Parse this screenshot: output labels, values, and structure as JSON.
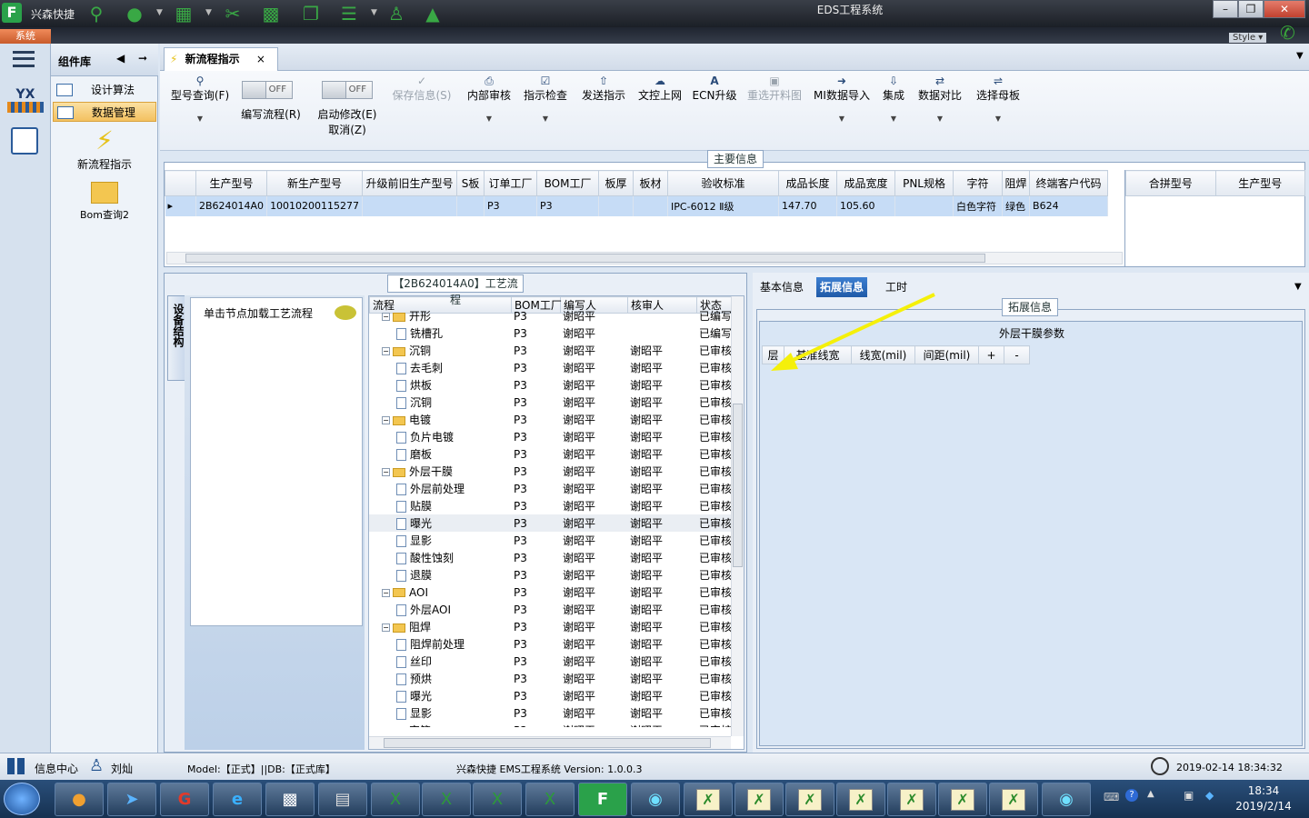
{
  "app": {
    "name": "兴森快捷",
    "window_title": "EDS工程系统",
    "system_tab": "系统",
    "style_label": "Style"
  },
  "left_nav": {
    "yx_label": "YX"
  },
  "component_panel": {
    "title": "组件库",
    "items": [
      {
        "label": "设计算法"
      },
      {
        "label": "数据管理"
      }
    ],
    "tools": [
      {
        "label": "新流程指示"
      },
      {
        "label": "Bom查询2"
      }
    ]
  },
  "doc_tab": {
    "label": "新流程指示",
    "close": "×"
  },
  "toolbar": {
    "buttons": [
      {
        "label": "型号查询(F)",
        "icon": "search-icon",
        "disabled": false
      },
      {
        "label": "保存信息(S)",
        "icon": "check-icon",
        "disabled": true
      },
      {
        "label": "内部审核",
        "icon": "print-icon",
        "disabled": false
      },
      {
        "label": "指示检查",
        "icon": "check-icon",
        "disabled": false
      },
      {
        "label": "发送指示",
        "icon": "upload-icon",
        "disabled": false
      },
      {
        "label": "文控上网",
        "icon": "cloud-upload-icon",
        "disabled": false
      },
      {
        "label": "ECN升级",
        "icon": "ecn-icon",
        "disabled": false
      },
      {
        "label": "重选开料图",
        "icon": "image-icon",
        "disabled": true
      },
      {
        "label": "MI数据导入",
        "icon": "import-icon",
        "disabled": false
      },
      {
        "label": "集成",
        "icon": "download-icon",
        "disabled": false
      },
      {
        "label": "数据对比",
        "icon": "compare-icon",
        "disabled": false
      },
      {
        "label": "选择母板",
        "icon": "shuffle-icon",
        "disabled": false
      }
    ],
    "toggles": [
      {
        "state": "OFF",
        "label": "编写流程(R)"
      },
      {
        "state": "OFF",
        "label": "启动修改(E)",
        "label2": "取消(Z)"
      }
    ]
  },
  "main_info": {
    "title": "主要信息",
    "columns": [
      "生产型号",
      "新生产型号",
      "升级前旧生产型号",
      "S板",
      "订单工厂",
      "BOM工厂",
      "板厚",
      "板材",
      "验收标准",
      "成品长度",
      "成品宽度",
      "PNL规格",
      "字符",
      "阻焊",
      "终端客户代码"
    ],
    "rows": [
      [
        "2B624014A0",
        "10010200115277",
        "",
        "",
        "P3",
        "P3",
        "",
        "",
        "IPC-6012 Ⅱ级",
        "147.70",
        "105.60",
        "",
        "白色字符",
        "绿色",
        "B624"
      ]
    ],
    "side_columns": [
      "合拼型号",
      "生产型号"
    ]
  },
  "process": {
    "title": "【2B624014A0】工艺流程",
    "vertical_tab": "设备结构",
    "hint": "单击节点加载工艺流程",
    "columns": [
      "流程",
      "BOM工厂",
      "编写人",
      "核审人",
      "状态"
    ],
    "rows": [
      {
        "name": "开形",
        "type": "folder",
        "indent": 1,
        "bom": "P3",
        "writer": "谢昭平",
        "reviewer": "",
        "status": "已编写"
      },
      {
        "name": "铣槽孔",
        "type": "file",
        "indent": 2,
        "bom": "P3",
        "writer": "谢昭平",
        "reviewer": "",
        "status": "已编写"
      },
      {
        "name": "沉铜",
        "type": "folder",
        "indent": 1,
        "bom": "P3",
        "writer": "谢昭平",
        "reviewer": "谢昭平",
        "status": "已审核"
      },
      {
        "name": "去毛刺",
        "type": "file",
        "indent": 2,
        "bom": "P3",
        "writer": "谢昭平",
        "reviewer": "谢昭平",
        "status": "已审核"
      },
      {
        "name": "烘板",
        "type": "file",
        "indent": 2,
        "bom": "P3",
        "writer": "谢昭平",
        "reviewer": "谢昭平",
        "status": "已审核"
      },
      {
        "name": "沉铜",
        "type": "file",
        "indent": 2,
        "bom": "P3",
        "writer": "谢昭平",
        "reviewer": "谢昭平",
        "status": "已审核"
      },
      {
        "name": "电镀",
        "type": "folder",
        "indent": 1,
        "bom": "P3",
        "writer": "谢昭平",
        "reviewer": "谢昭平",
        "status": "已审核"
      },
      {
        "name": "负片电镀",
        "type": "file",
        "indent": 2,
        "bom": "P3",
        "writer": "谢昭平",
        "reviewer": "谢昭平",
        "status": "已审核"
      },
      {
        "name": "磨板",
        "type": "file",
        "indent": 2,
        "bom": "P3",
        "writer": "谢昭平",
        "reviewer": "谢昭平",
        "status": "已审核"
      },
      {
        "name": "外层干膜",
        "type": "folder",
        "indent": 1,
        "bom": "P3",
        "writer": "谢昭平",
        "reviewer": "谢昭平",
        "status": "已审核"
      },
      {
        "name": "外层前处理",
        "type": "file",
        "indent": 2,
        "bom": "P3",
        "writer": "谢昭平",
        "reviewer": "谢昭平",
        "status": "已审核"
      },
      {
        "name": "贴膜",
        "type": "file",
        "indent": 2,
        "bom": "P3",
        "writer": "谢昭平",
        "reviewer": "谢昭平",
        "status": "已审核"
      },
      {
        "name": "曝光",
        "type": "file",
        "indent": 2,
        "bom": "P3",
        "writer": "谢昭平",
        "reviewer": "谢昭平",
        "status": "已审核",
        "highlight": true
      },
      {
        "name": "显影",
        "type": "file",
        "indent": 2,
        "bom": "P3",
        "writer": "谢昭平",
        "reviewer": "谢昭平",
        "status": "已审核"
      },
      {
        "name": "酸性蚀刻",
        "type": "file",
        "indent": 2,
        "bom": "P3",
        "writer": "谢昭平",
        "reviewer": "谢昭平",
        "status": "已审核"
      },
      {
        "name": "退膜",
        "type": "file",
        "indent": 2,
        "bom": "P3",
        "writer": "谢昭平",
        "reviewer": "谢昭平",
        "status": "已审核"
      },
      {
        "name": "AOI",
        "type": "folder",
        "indent": 1,
        "bom": "P3",
        "writer": "谢昭平",
        "reviewer": "谢昭平",
        "status": "已审核"
      },
      {
        "name": "外层AOI",
        "type": "file",
        "indent": 2,
        "bom": "P3",
        "writer": "谢昭平",
        "reviewer": "谢昭平",
        "status": "已审核"
      },
      {
        "name": "阻焊",
        "type": "folder",
        "indent": 1,
        "bom": "P3",
        "writer": "谢昭平",
        "reviewer": "谢昭平",
        "status": "已审核"
      },
      {
        "name": "阻焊前处理",
        "type": "file",
        "indent": 2,
        "bom": "P3",
        "writer": "谢昭平",
        "reviewer": "谢昭平",
        "status": "已审核"
      },
      {
        "name": "丝印",
        "type": "file",
        "indent": 2,
        "bom": "P3",
        "writer": "谢昭平",
        "reviewer": "谢昭平",
        "status": "已审核"
      },
      {
        "name": "预烘",
        "type": "file",
        "indent": 2,
        "bom": "P3",
        "writer": "谢昭平",
        "reviewer": "谢昭平",
        "status": "已审核"
      },
      {
        "name": "曝光",
        "type": "file",
        "indent": 2,
        "bom": "P3",
        "writer": "谢昭平",
        "reviewer": "谢昭平",
        "status": "已审核"
      },
      {
        "name": "显影",
        "type": "file",
        "indent": 2,
        "bom": "P3",
        "writer": "谢昭平",
        "reviewer": "谢昭平",
        "status": "已审核"
      },
      {
        "name": "字符",
        "type": "folder",
        "indent": 1,
        "bom": "P3",
        "writer": "谢昭平",
        "reviewer": "谢昭平",
        "status": "已审核"
      }
    ]
  },
  "right_panel": {
    "tabs": [
      {
        "label": "基本信息",
        "selected": false
      },
      {
        "label": "拓展信息",
        "selected": true
      },
      {
        "label": "工时",
        "selected": false
      }
    ],
    "group_title": "拓展信息",
    "table_title": "外层干膜参数",
    "columns": [
      "层",
      "基准线宽",
      "线宽(mil)",
      "间距(mil)",
      "+",
      "-"
    ],
    "annotation_color": "#f5f00a"
  },
  "statusbar": {
    "info_center": "信息中心",
    "user": "刘灿",
    "model_db": "Model:【正式】||DB:【正式库】",
    "version": "兴森快捷 EMS工程系统 Version: 1.0.0.3",
    "datetime": "2019-02-14 18:34:32"
  },
  "taskbar": {
    "time": "18:34",
    "date": "2019/2/14"
  }
}
